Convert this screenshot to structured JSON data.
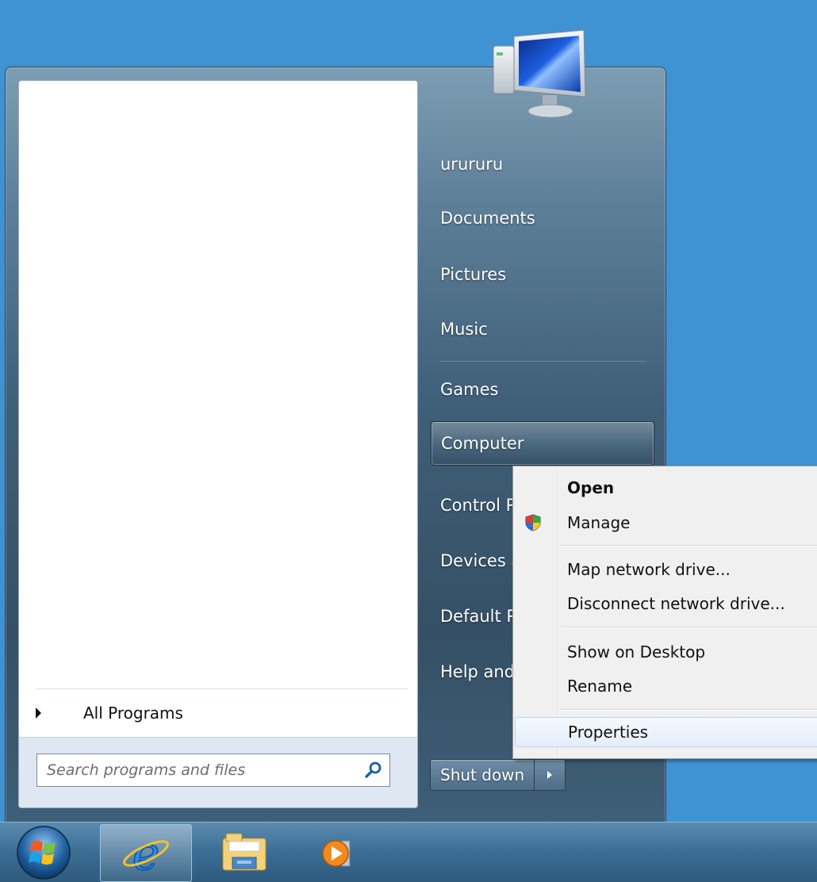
{
  "start_menu": {
    "user_name": "urururu",
    "right_items": {
      "documents": "Documents",
      "pictures": "Pictures",
      "music": "Music",
      "games": "Games",
      "computer": "Computer",
      "control_panel": "Control Panel",
      "devices": "Devices and Printers",
      "default_programs": "Default Programs",
      "help": "Help and Support"
    },
    "all_programs": "All Programs",
    "search_placeholder": "Search programs and files",
    "shutdown_label": "Shut down"
  },
  "context_menu": {
    "items": {
      "open": "Open",
      "manage": "Manage",
      "map_drive": "Map network drive...",
      "disconnect_drive": "Disconnect network drive...",
      "show_desktop": "Show on Desktop",
      "rename": "Rename",
      "properties": "Properties"
    }
  },
  "colors": {
    "desktop": "#3f93d2",
    "menu_accent": "#355066"
  },
  "icons": {
    "user_picture": "computer-monitor-icon",
    "search": "magnifier-icon",
    "shield": "uac-shield-icon"
  }
}
